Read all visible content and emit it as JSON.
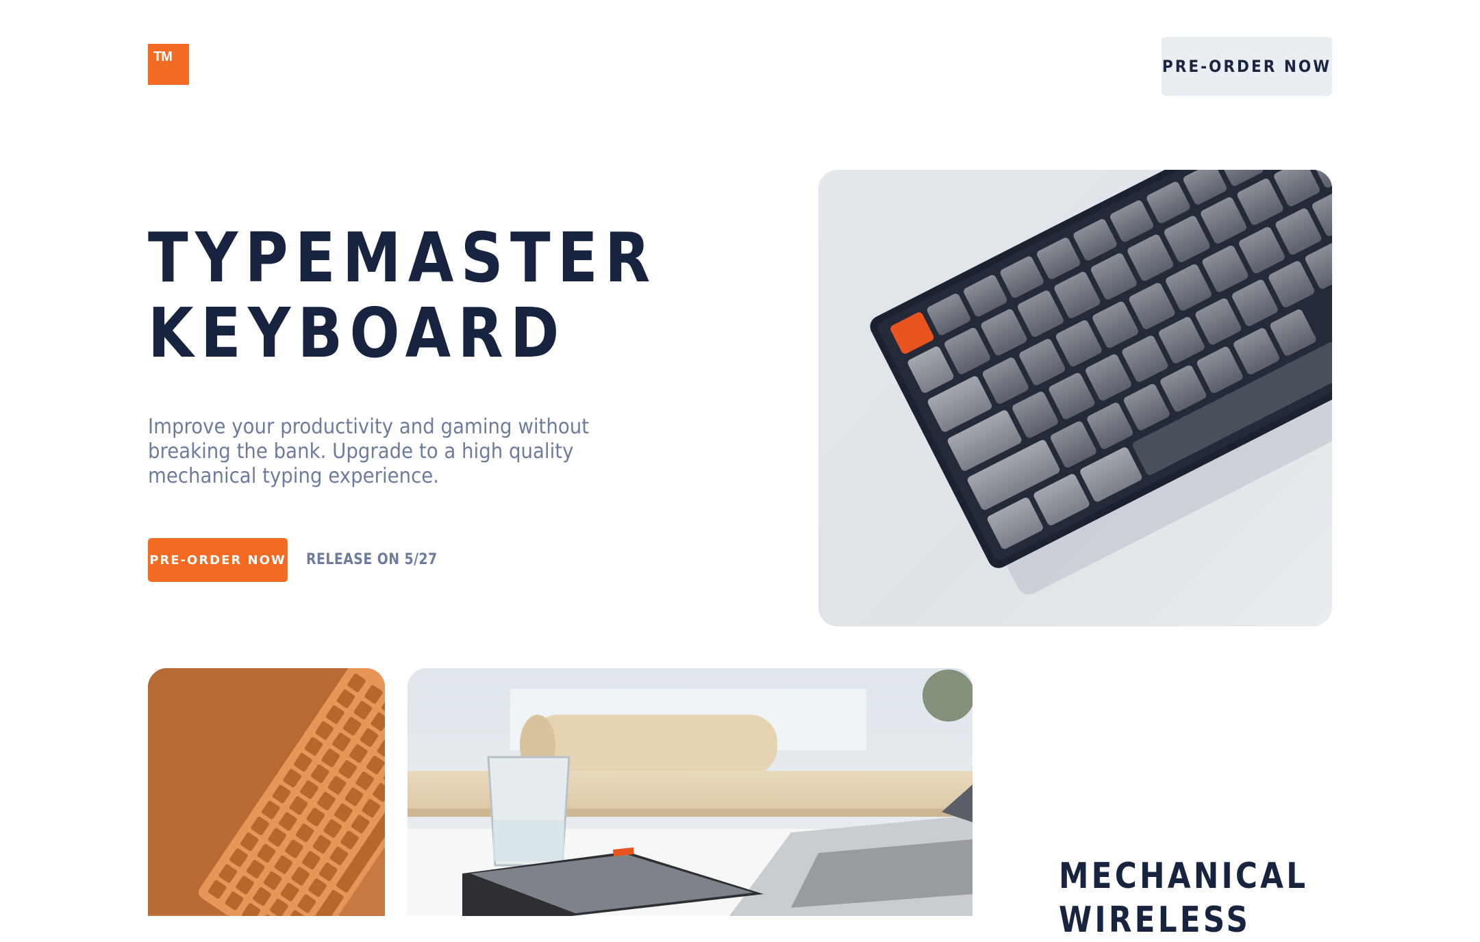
{
  "header": {
    "logo_text": "TM",
    "cta_label": "PRE-ORDER NOW"
  },
  "hero": {
    "title_line1": "TYPEMASTER",
    "title_line2": "KEYBOARD",
    "description": "Improve your productivity and gaming without breaking the bank. Upgrade to a high quality mechanical typing experience.",
    "cta_label": "PRE-ORDER NOW",
    "release_text": "RELEASE ON 5/27",
    "image_icon": "keyboard-photo"
  },
  "gallery": {
    "tile1_icon": "orange-keyboard-photo",
    "tile2_icon": "desk-keyboard-photo"
  },
  "features": {
    "title_line1": "MECHANICAL",
    "title_line2": "WIRELESS"
  },
  "colors": {
    "accent": "#f36a22",
    "navy": "#182340",
    "muted": "#6f7b9c",
    "button_light": "#e9eef2"
  }
}
